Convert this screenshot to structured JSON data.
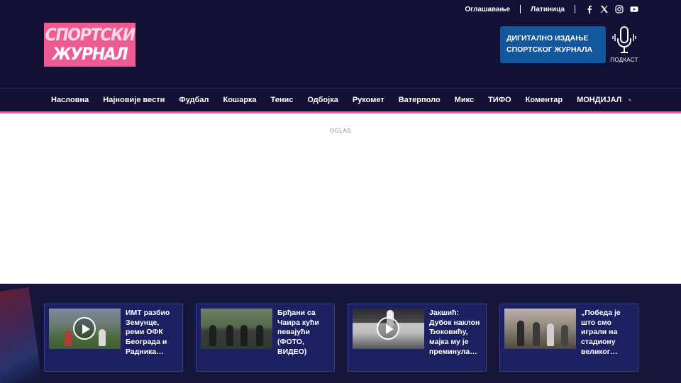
{
  "topbar": {
    "ads_link": "Оглашавање",
    "script_link": "Латиница",
    "social_icons": [
      "facebook-icon",
      "x-icon",
      "instagram-icon",
      "youtube-icon"
    ]
  },
  "logo": {
    "line1": "СПОРТСКИ",
    "line2": "ЖУРНАЛ"
  },
  "digital_edition": {
    "line1": "ДИГИТАЛНО ИЗДАЊЕ",
    "line2": "СПОРТСКОГ ЖУРНАЛА"
  },
  "podcast": {
    "label": "ПОДКАСТ"
  },
  "nav": {
    "items": [
      "Насловна",
      "Најновије вести",
      "Фудбал",
      "Кошарка",
      "Тенис",
      "Одбојка",
      "Рукомет",
      "Ватерполо",
      "Микс",
      "ТИФО",
      "Коментар",
      "МОНДИЈАЛ"
    ],
    "search_icon": "search-icon"
  },
  "ad": {
    "label": "OGLAS"
  },
  "featured": [
    {
      "title": "ИМТ разбио Земунце, реми ОФК Београда и Радника…",
      "video": true
    },
    {
      "title": "Брђани са Чаира кући певајући (ФОТО, ВИДЕО)",
      "video": false
    },
    {
      "title": "Јакшић: Дубок наклон Ђоковићу, мајка му је преминула…",
      "video": true
    },
    {
      "title": "„Победа је што смо играли на стадиону великог…",
      "video": false
    }
  ],
  "colors": {
    "header_bg": "#101134",
    "accent_pink": "#ee5b93",
    "digital_blue": "#11579e",
    "band_bg": "#15163a",
    "card_bg": "#1c2060"
  }
}
